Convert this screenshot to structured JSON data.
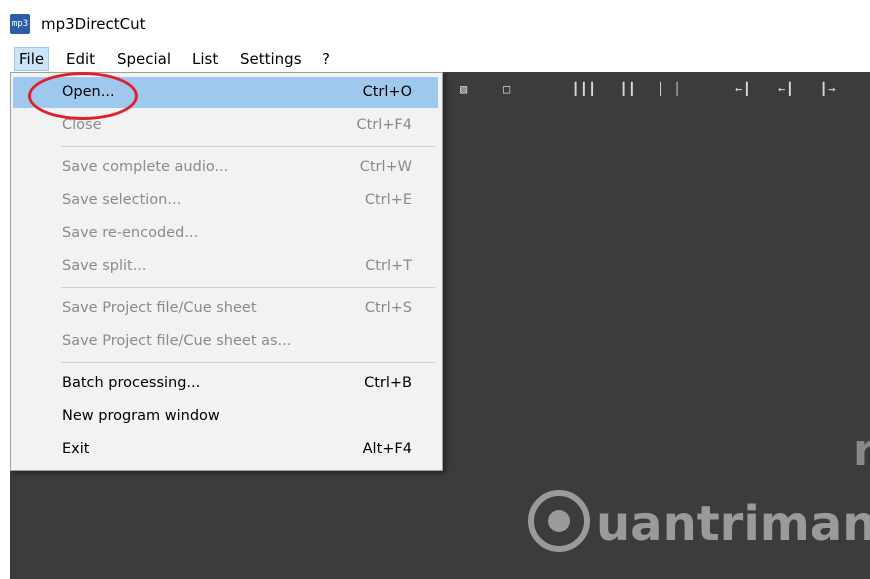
{
  "window": {
    "title": "mp3DirectCut",
    "icon": "mp3-app-icon",
    "icon_text": "mp3"
  },
  "menubar": {
    "items": [
      {
        "label": "File",
        "active": true
      },
      {
        "label": "Edit"
      },
      {
        "label": "Special"
      },
      {
        "label": "List"
      },
      {
        "label": "Settings"
      },
      {
        "label": "?"
      }
    ]
  },
  "file_menu": {
    "items": [
      {
        "label": "Open...",
        "shortcut": "Ctrl+O",
        "enabled": true,
        "highlighted": true
      },
      {
        "label": "Close",
        "shortcut": "Ctrl+F4",
        "enabled": false
      },
      {
        "label": "Save complete audio...",
        "shortcut": "Ctrl+W",
        "enabled": false
      },
      {
        "label": "Save selection...",
        "shortcut": "Ctrl+E",
        "enabled": false
      },
      {
        "label": "Save re-encoded...",
        "shortcut": "",
        "enabled": false
      },
      {
        "label": "Save split...",
        "shortcut": "Ctrl+T",
        "enabled": false
      },
      {
        "label": "Save Project file/Cue sheet",
        "shortcut": "Ctrl+S",
        "enabled": false
      },
      {
        "label": "Save Project file/Cue sheet as...",
        "shortcut": "",
        "enabled": false
      },
      {
        "label": "Batch processing...",
        "shortcut": "Ctrl+B",
        "enabled": true
      },
      {
        "label": "New program window",
        "shortcut": "",
        "enabled": true
      },
      {
        "label": "Exit",
        "shortcut": "Alt+F4",
        "enabled": true
      }
    ]
  },
  "toolbar": {
    "icons": [
      "page-2-icon",
      "page-blank-icon",
      "split-bars-icon",
      "double-bar-icon",
      "single-bars-icon",
      "move-left-icon",
      "move-left-2-icon",
      "move-right-icon"
    ]
  },
  "watermark": {
    "text": "uantrimang",
    "logo_icon": "lightbulb-logo-icon"
  },
  "colors": {
    "workspace": "#3c3c3c",
    "highlight": "#9fc8ee",
    "annotation": "#e0212a",
    "menu_bg": "#f2f2f2"
  }
}
